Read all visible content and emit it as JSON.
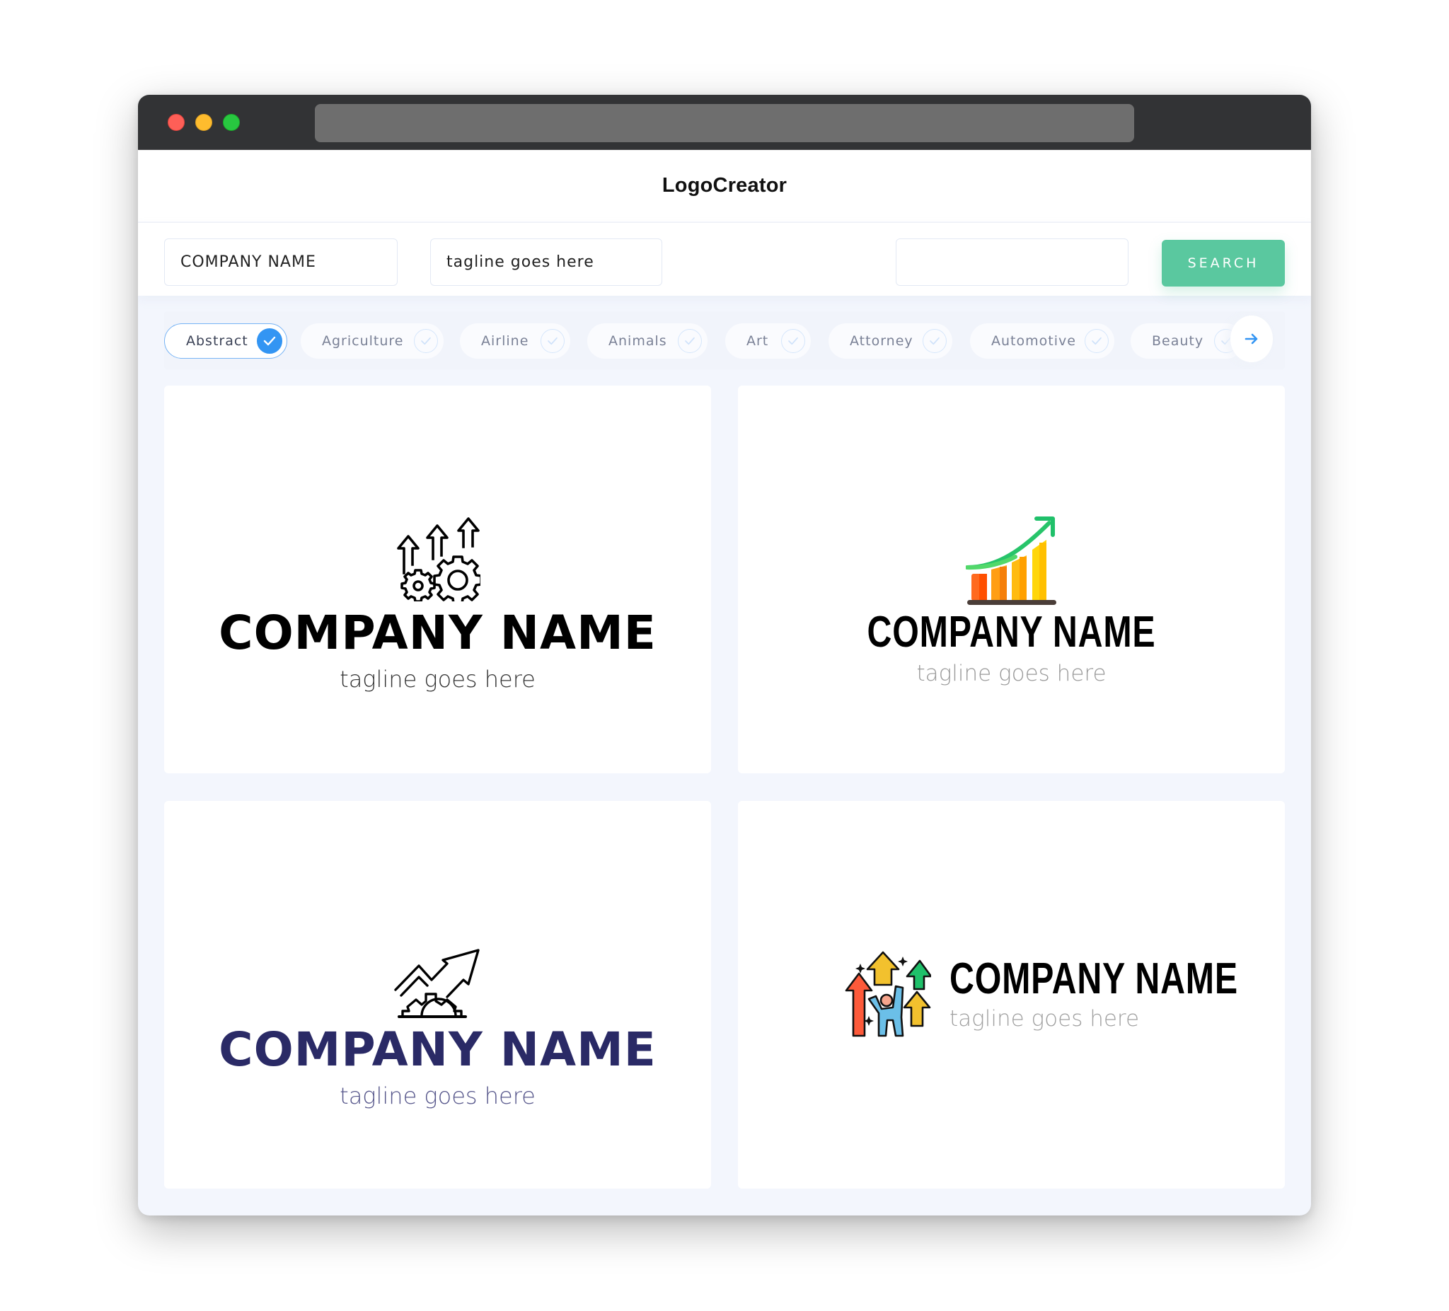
{
  "window": {
    "controls": [
      "close",
      "minimize",
      "maximize"
    ]
  },
  "header": {
    "title": "LogoCreator"
  },
  "search": {
    "company_name_value": "COMPANY NAME",
    "tagline_value": "tagline goes here",
    "keyword_value": "",
    "button_label": "SEARCH",
    "accent_color": "#5ac89f"
  },
  "categories": {
    "items": [
      {
        "label": "Abstract",
        "selected": true
      },
      {
        "label": "Agriculture",
        "selected": false
      },
      {
        "label": "Airline",
        "selected": false
      },
      {
        "label": "Animals",
        "selected": false
      },
      {
        "label": "Art",
        "selected": false
      },
      {
        "label": "Attorney",
        "selected": false
      },
      {
        "label": "Automotive",
        "selected": false
      },
      {
        "label": "Beauty",
        "selected": false
      }
    ],
    "next_icon": "arrow-right-icon",
    "selected_color": "#3395f3"
  },
  "logos": [
    {
      "icon": "arrows-gears-icon",
      "name": "COMPANY NAME",
      "tagline": "tagline goes here",
      "name_color": "#000000",
      "tagline_color": "#333333",
      "layout": "stacked"
    },
    {
      "icon": "bar-chart-growth-icon",
      "name": "COMPANY NAME",
      "tagline": "tagline goes here",
      "name_color": "#000000",
      "tagline_color": "#9a9a9a",
      "layout": "stacked"
    },
    {
      "icon": "gear-trend-arrow-icon",
      "name": "COMPANY NAME",
      "tagline": "tagline goes here",
      "name_color": "#2a2a66",
      "tagline_color": "#55558a",
      "layout": "stacked"
    },
    {
      "icon": "person-arrows-icon",
      "name": "COMPANY NAME",
      "tagline": "tagline goes here",
      "name_color": "#000000",
      "tagline_color": "#a0a0a0",
      "layout": "inline"
    }
  ]
}
